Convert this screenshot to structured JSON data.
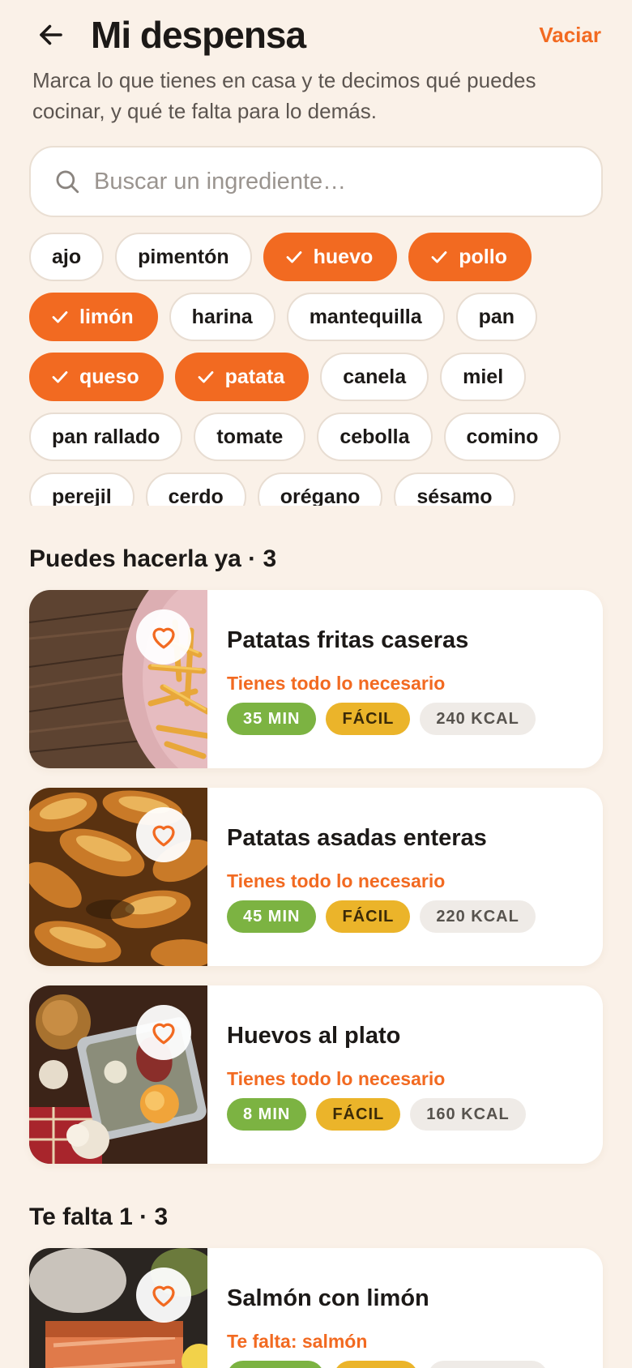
{
  "header": {
    "title": "Mi despensa",
    "clear_label": "Vaciar",
    "subtitle": "Marca lo que tienes en casa y te decimos qué puedes cocinar, y qué te falta para lo demás."
  },
  "search": {
    "placeholder": "Buscar un ingrediente…",
    "value": ""
  },
  "ingredients": [
    {
      "label": "ajo",
      "selected": false
    },
    {
      "label": "pimentón",
      "selected": false
    },
    {
      "label": "huevo",
      "selected": true
    },
    {
      "label": "pollo",
      "selected": true
    },
    {
      "label": "limón",
      "selected": true
    },
    {
      "label": "harina",
      "selected": false
    },
    {
      "label": "mantequilla",
      "selected": false
    },
    {
      "label": "pan",
      "selected": false
    },
    {
      "label": "queso",
      "selected": true
    },
    {
      "label": "patata",
      "selected": true
    },
    {
      "label": "canela",
      "selected": false
    },
    {
      "label": "miel",
      "selected": false
    },
    {
      "label": "pan rallado",
      "selected": false
    },
    {
      "label": "tomate",
      "selected": false
    },
    {
      "label": "cebolla",
      "selected": false
    },
    {
      "label": "comino",
      "selected": false
    },
    {
      "label": "perejil",
      "selected": false
    },
    {
      "label": "cerdo",
      "selected": false
    },
    {
      "label": "orégano",
      "selected": false
    },
    {
      "label": "sésamo",
      "selected": false
    }
  ],
  "sections": {
    "ready": {
      "title": "Puedes hacerla ya · 3"
    },
    "missing_one": {
      "title": "Te falta 1 · 3"
    }
  },
  "recipes": [
    {
      "name": "Patatas fritas caseras",
      "status": "Tienes todo lo necesario",
      "time": "35 MIN",
      "difficulty": "FÁCIL",
      "kcal": "240 KCAL"
    },
    {
      "name": "Patatas asadas enteras",
      "status": "Tienes todo lo necesario",
      "time": "45 MIN",
      "difficulty": "FÁCIL",
      "kcal": "220 KCAL"
    },
    {
      "name": "Huevos al plato",
      "status": "Tienes todo lo necesario",
      "time": "8 MIN",
      "difficulty": "FÁCIL",
      "kcal": "160 KCAL"
    },
    {
      "name": "Salmón con limón",
      "status": "Te falta: salmón",
      "time": "",
      "difficulty": "",
      "kcal": ""
    }
  ],
  "colors": {
    "accent": "#f26a21",
    "background": "#faf1e8",
    "time_badge": "#7cb342",
    "difficulty_badge": "#ebb42a",
    "kcal_badge": "#efebe7"
  },
  "icons": {
    "back": "arrow-left-icon",
    "search": "search-icon",
    "check": "check-icon",
    "favorite": "heart-outline-icon"
  }
}
